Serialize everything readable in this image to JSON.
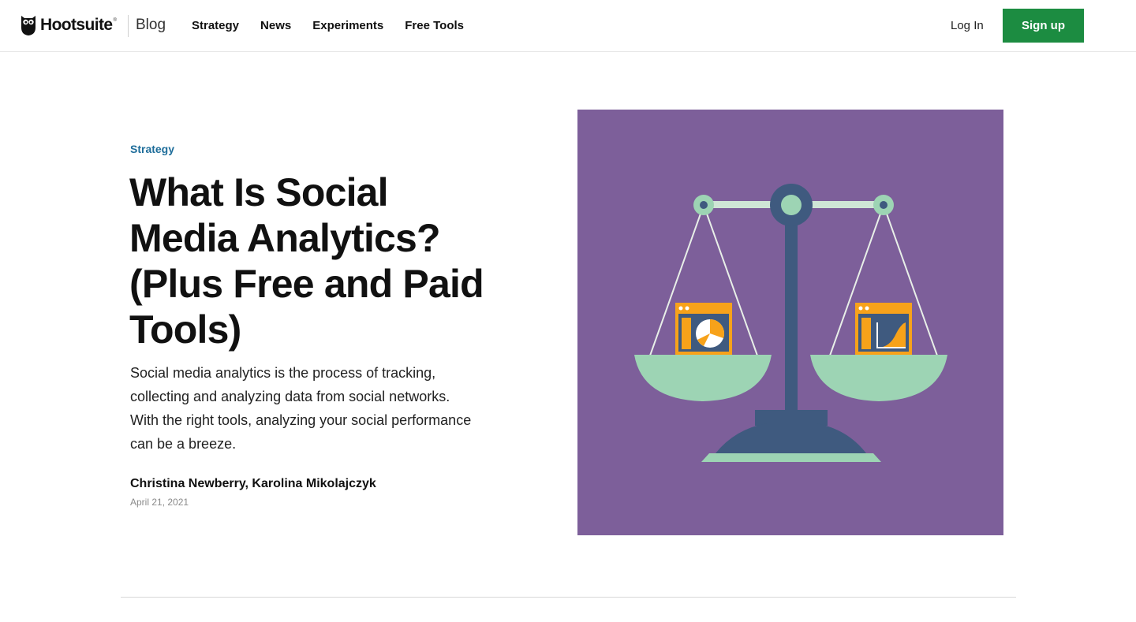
{
  "header": {
    "brand": "Hootsuite",
    "brand_mark": "®",
    "section": "Blog",
    "nav": [
      {
        "label": "Strategy"
      },
      {
        "label": "News"
      },
      {
        "label": "Experiments"
      },
      {
        "label": "Free Tools"
      }
    ],
    "login_label": "Log In",
    "signup_label": "Sign up"
  },
  "article": {
    "category": "Strategy",
    "title": "What Is Social Media Analytics? (Plus Free and Paid Tools)",
    "dek": "Social media analytics is the process of tracking, collecting and analyzing data from social networks. With the right tools, analyzing your social performance can be a breeze.",
    "authors": "Christina Newberry, Karolina Mikolajczyk",
    "date": "April 21, 2021"
  },
  "hero_image": {
    "icon": "balance-scale-illustration",
    "colors": {
      "background": "#7d5f9a",
      "stand": "#3f5a7f",
      "pan": "#9dd4b4",
      "screen": "#f7a21a"
    }
  },
  "colors": {
    "accent_green": "#1c8c41",
    "category_blue": "#1e6d9a"
  }
}
